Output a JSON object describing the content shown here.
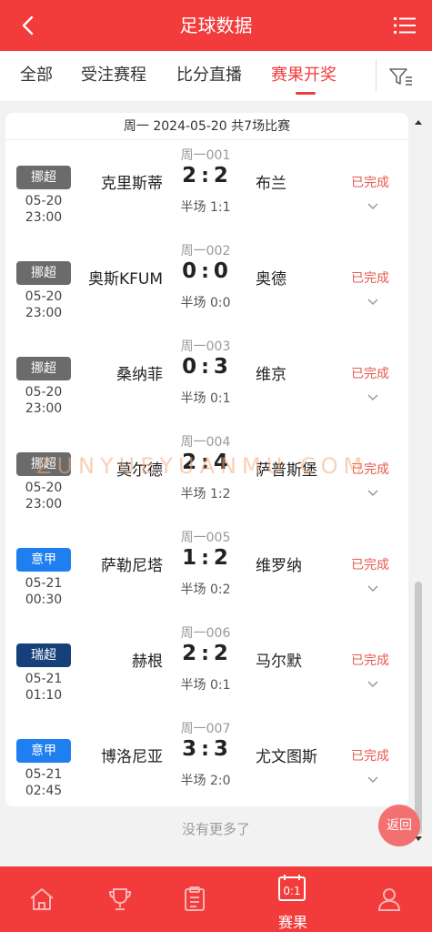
{
  "header": {
    "title": "足球数据"
  },
  "tabs": [
    {
      "label": "全部"
    },
    {
      "label": "受注赛程"
    },
    {
      "label": "比分直播"
    },
    {
      "label": "赛果开奖"
    }
  ],
  "date_line": "周一  2024-05-20  共7场比赛",
  "matches": [
    {
      "no": "周一001",
      "league": "挪超",
      "date": "05-20",
      "time": "23:00",
      "home": "克里斯蒂",
      "hs": "2",
      "as": "2",
      "half": "半场 1:1",
      "away": "布兰",
      "status": "已完成"
    },
    {
      "no": "周一002",
      "league": "挪超",
      "date": "05-20",
      "time": "23:00",
      "home": "奥斯KFUM",
      "hs": "0",
      "as": "0",
      "half": "半场 0:0",
      "away": "奥德",
      "status": "已完成"
    },
    {
      "no": "周一003",
      "league": "挪超",
      "date": "05-20",
      "time": "23:00",
      "home": "桑纳菲",
      "hs": "0",
      "as": "3",
      "half": "半场 0:1",
      "away": "维京",
      "status": "已完成"
    },
    {
      "no": "周一004",
      "league": "挪超",
      "date": "05-20",
      "time": "23:00",
      "home": "莫尔德",
      "hs": "2",
      "as": "4",
      "half": "半场 1:2",
      "away": "萨普斯堡",
      "status": "已完成"
    },
    {
      "no": "周一005",
      "league": "意甲",
      "date": "05-21",
      "time": "00:30",
      "home": "萨勒尼塔",
      "hs": "1",
      "as": "2",
      "half": "半场 0:2",
      "away": "维罗纳",
      "status": "已完成"
    },
    {
      "no": "周一006",
      "league": "瑞超",
      "date": "05-21",
      "time": "01:10",
      "home": "赫根",
      "hs": "2",
      "as": "2",
      "half": "半场 0:1",
      "away": "马尔默",
      "status": "已完成"
    },
    {
      "no": "周一007",
      "league": "意甲",
      "date": "05-21",
      "time": "02:45",
      "home": "博洛尼亚",
      "hs": "3",
      "as": "3",
      "half": "半场 2:0",
      "away": "尤文图斯",
      "status": "已完成"
    }
  ],
  "league_colors": {
    "挪超": "#6b6b6b",
    "意甲": "#1f7ef0",
    "瑞超": "#15407a"
  },
  "no_more": "没有更多了",
  "back_button": "返回",
  "watermark": "ZUNYUEYUANMU.COM",
  "bottom_nav": [
    {
      "icon": "home-icon",
      "label": ""
    },
    {
      "icon": "trophy-icon",
      "label": ""
    },
    {
      "icon": "clipboard-icon",
      "label": ""
    },
    {
      "icon": "scoreboard-icon",
      "label": "赛果"
    },
    {
      "icon": "user-icon",
      "label": ""
    }
  ],
  "colors": {
    "accent": "#f23b3b",
    "status": "#e85a4f"
  }
}
